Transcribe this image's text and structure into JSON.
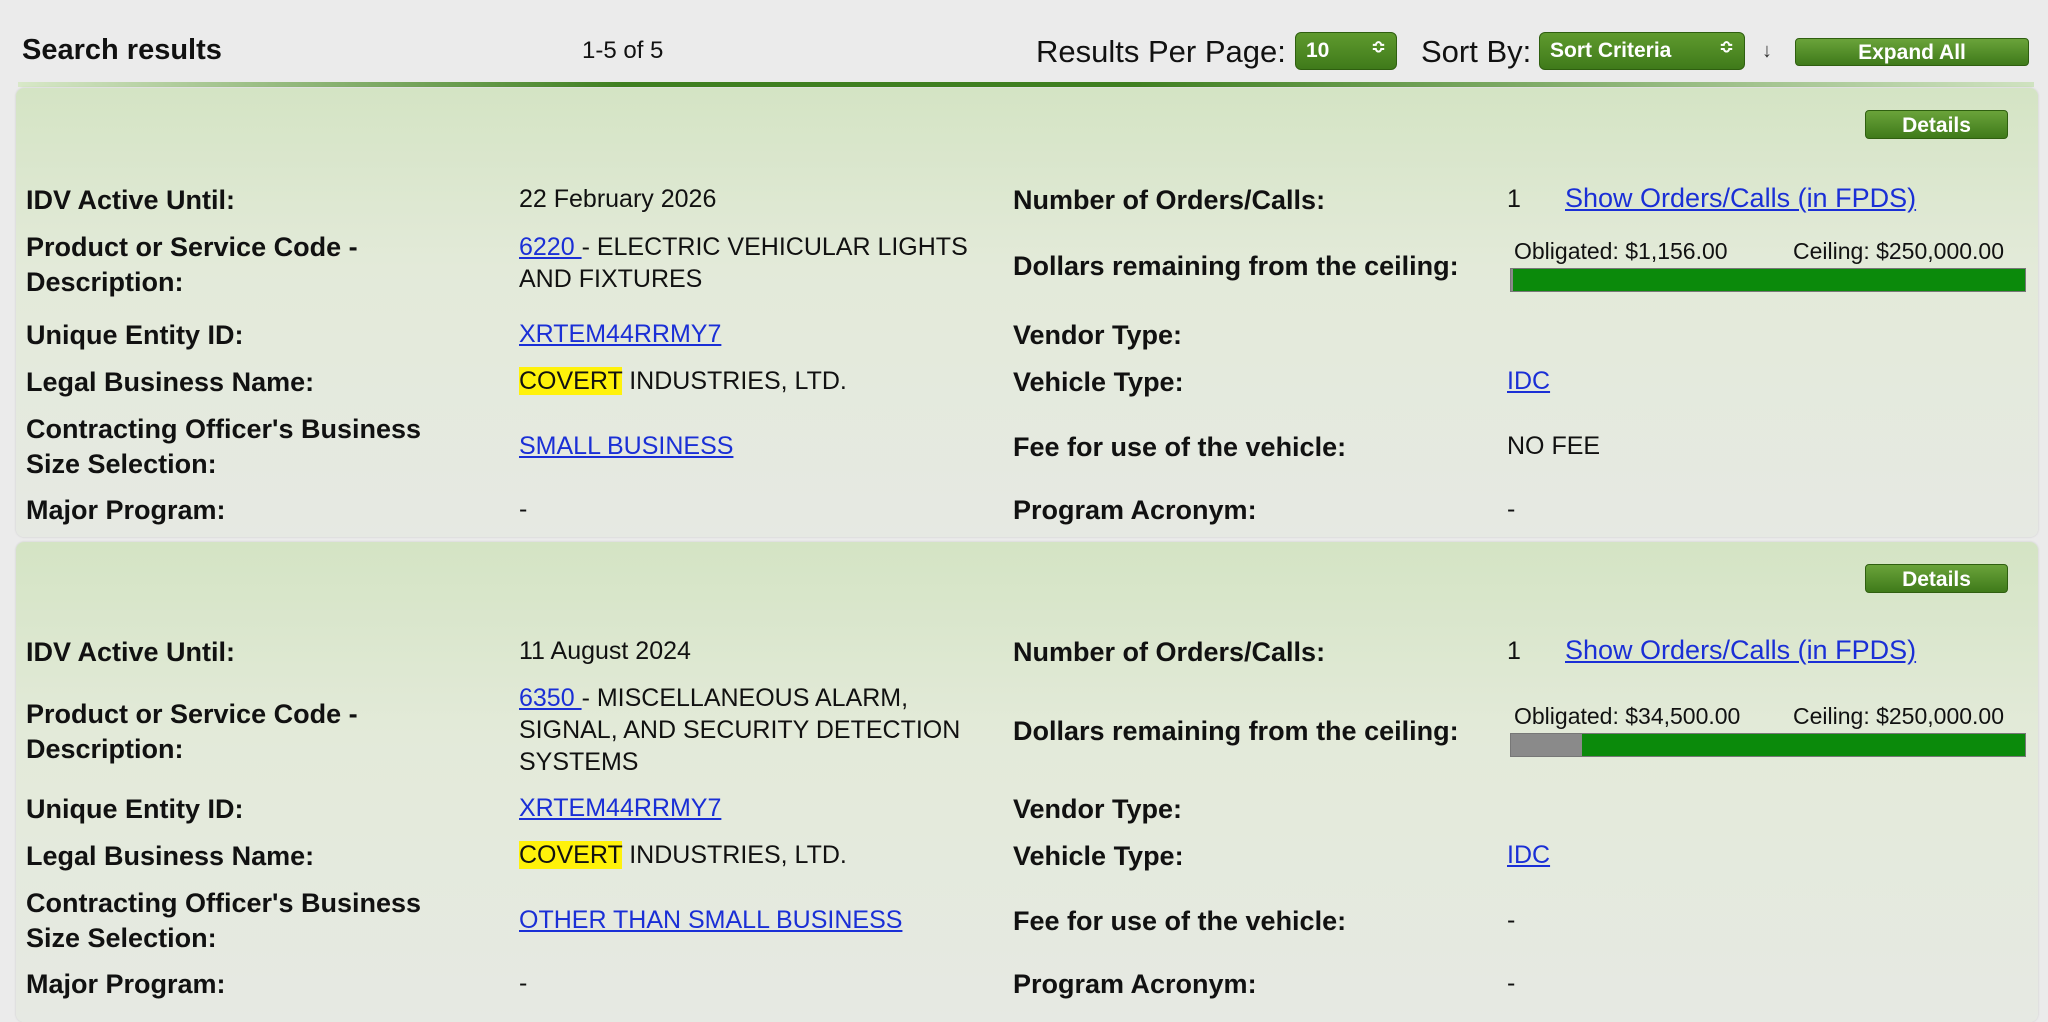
{
  "header": {
    "title": "Search results",
    "count": "1-5 of 5",
    "rpp_label": "Results Per Page:",
    "rpp_value": "10",
    "sort_label": "Sort By:",
    "sort_value": "Sort Criteria",
    "expand_label": "Expand All",
    "sort_dir_icon": "↓",
    "select_arrow_icon": "≎"
  },
  "labels": {
    "details": "Details",
    "idv": "IDV Active Until:",
    "psc_line1": "Product or Service Code -",
    "psc_line2": "Description:",
    "uei": "Unique Entity ID:",
    "lbn": "Legal Business Name:",
    "size_line1": "Contracting Officer's Business",
    "size_line2": "Size Selection:",
    "major": "Major Program:",
    "orders": "Number of Orders/Calls:",
    "dollars": "Dollars remaining from the ceiling:",
    "vendor": "Vendor Type:",
    "vehicle": "Vehicle Type:",
    "fee": "Fee for use of the vehicle:",
    "acronym": "Program Acronym:"
  },
  "results": [
    {
      "idv_active_until": "22 February 2026",
      "psc_code": "6220 ",
      "psc_desc_line1": "- ELECTRIC VEHICULAR LIGHTS",
      "psc_desc_line2": "AND FIXTURES",
      "uei": "XRTEM44RRMY7",
      "lbn_highlight": "COVERT",
      "lbn_rest": " INDUSTRIES, LTD.",
      "size": "SMALL BUSINESS",
      "major_program": "-",
      "orders_count": "1",
      "orders_link": "Show Orders/Calls (in FPDS)",
      "obligated": "Obligated: $1,156.00",
      "ceiling": "Ceiling: $250,000.00",
      "obligated_fraction": 0.0046,
      "vendor_type": "",
      "vehicle_type": "IDC",
      "fee": "NO FEE",
      "program_acronym": "-"
    },
    {
      "idv_active_until": "11 August 2024",
      "psc_code": "6350 ",
      "psc_desc_line1": "- MISCELLANEOUS ALARM,",
      "psc_desc_line2": "SIGNAL, AND SECURITY DETECTION",
      "psc_desc_line3": "SYSTEMS",
      "uei": "XRTEM44RRMY7",
      "lbn_highlight": "COVERT",
      "lbn_rest": " INDUSTRIES, LTD.",
      "size": "OTHER THAN SMALL BUSINESS",
      "major_program": "-",
      "orders_count": "1",
      "orders_link": "Show Orders/Calls (in FPDS)",
      "obligated": "Obligated: $34,500.00",
      "ceiling": "Ceiling: $250,000.00",
      "obligated_fraction": 0.138,
      "vendor_type": "",
      "vehicle_type": "IDC",
      "fee": "-",
      "program_acronym": "-"
    }
  ],
  "colors": {
    "accent_green": "#3f7a1a",
    "bar_green": "#0b8a0b",
    "bar_used": "#8a8a8a",
    "highlight": "#fff20a",
    "link": "#1a2fd6"
  }
}
